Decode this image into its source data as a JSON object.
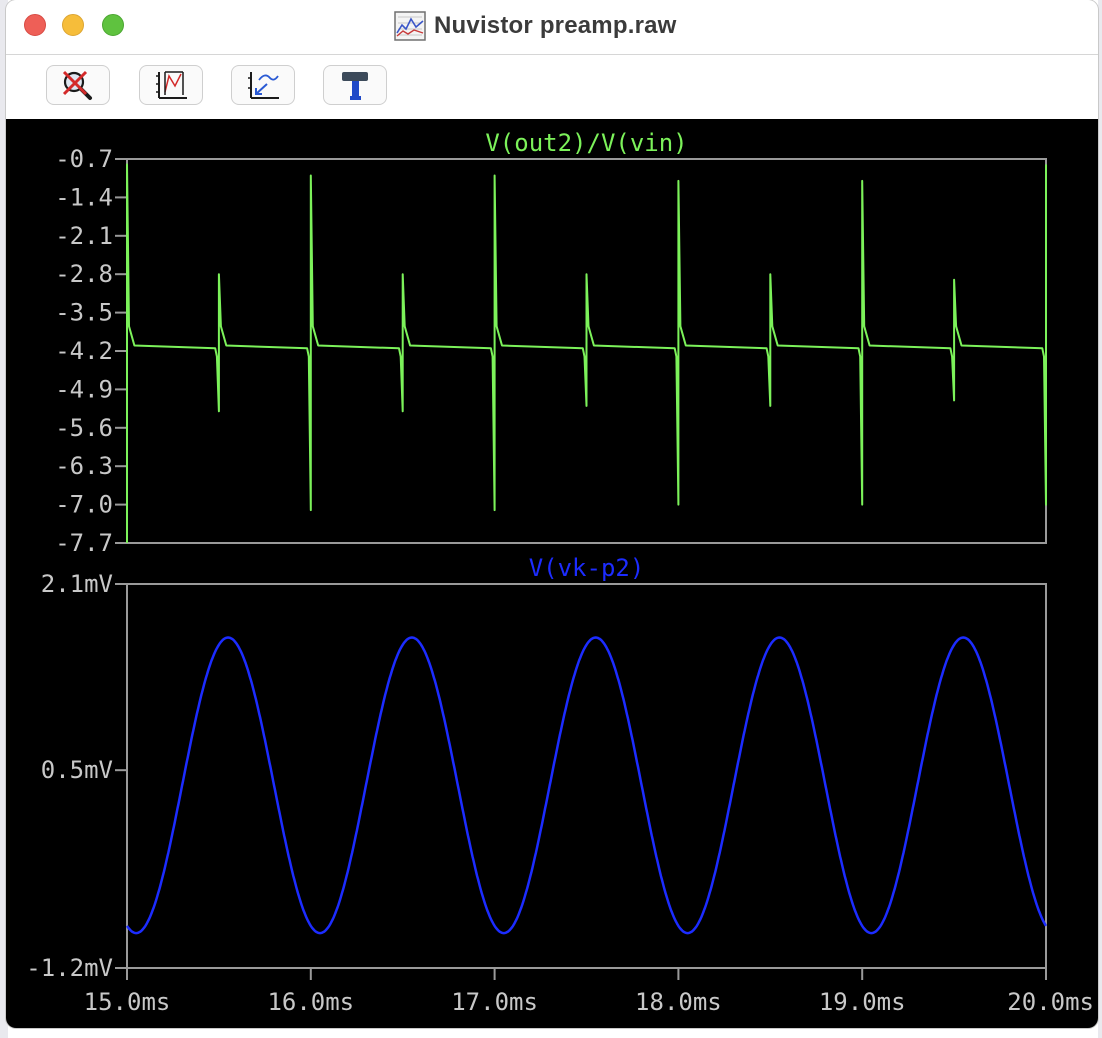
{
  "window": {
    "title": "Nuvistor preamp.raw",
    "title_icon": "waveform-document-icon"
  },
  "toolbar": {
    "buttons": [
      {
        "icon": "zoom-cancel-icon"
      },
      {
        "icon": "autorange-icon"
      },
      {
        "icon": "zoom-back-icon"
      },
      {
        "icon": "hammer-tool-icon"
      }
    ]
  },
  "colors": {
    "pane1_trace": "#7cf25a",
    "pane2_trace": "#1c2cff",
    "frame": "#9a9a9a",
    "background": "#000000",
    "tick_text": "#c8c8c8"
  },
  "chart_data": [
    {
      "type": "line",
      "title": "V(out2)/V(vin)",
      "xlabel": "",
      "ylabel": "",
      "xlim": [
        15.0,
        20.0
      ],
      "ylim": [
        -7.7,
        -0.7
      ],
      "yticks": [
        "-0.7",
        "-1.4",
        "-2.1",
        "-2.8",
        "-3.5",
        "-4.2",
        "-4.9",
        "-5.6",
        "-6.3",
        "-7.0",
        "-7.7"
      ],
      "grid": false,
      "baseline": -4.15,
      "spikes": [
        {
          "x": 15.0,
          "top": -0.8,
          "bottom": -7.7
        },
        {
          "x": 15.5,
          "top": -2.8,
          "bottom": -5.3
        },
        {
          "x": 16.0,
          "top": -1.0,
          "bottom": -7.1
        },
        {
          "x": 16.5,
          "top": -2.8,
          "bottom": -5.3
        },
        {
          "x": 17.0,
          "top": -1.0,
          "bottom": -7.1
        },
        {
          "x": 17.5,
          "top": -2.8,
          "bottom": -5.2
        },
        {
          "x": 18.0,
          "top": -1.1,
          "bottom": -7.0
        },
        {
          "x": 18.5,
          "top": -2.8,
          "bottom": -5.2
        },
        {
          "x": 19.0,
          "top": -1.1,
          "bottom": -7.0
        },
        {
          "x": 19.5,
          "top": -2.9,
          "bottom": -5.1
        },
        {
          "x": 20.0,
          "top": -0.8,
          "bottom": -7.0
        }
      ]
    },
    {
      "type": "line",
      "title": "V(vk-p2)",
      "xlabel": "",
      "ylabel": "",
      "xlim": [
        15.0,
        20.0
      ],
      "ylim": [
        -1.2,
        2.1
      ],
      "yticks": [
        "2.1mV",
        "0.5mV",
        "-1.2mV"
      ],
      "ytick_values": [
        2.1,
        0.5,
        -1.2
      ],
      "grid": false,
      "series": [
        {
          "waveform": "sine",
          "period_ms": 1.0,
          "offset_mV": 0.37,
          "amplitude_mV": 1.27,
          "phase_deg": 252
        }
      ]
    }
  ],
  "xaxis": {
    "ticks": [
      "15.0ms",
      "16.0ms",
      "17.0ms",
      "18.0ms",
      "19.0ms",
      "20.0ms"
    ],
    "tick_values": [
      15.0,
      16.0,
      17.0,
      18.0,
      19.0,
      20.0
    ]
  }
}
